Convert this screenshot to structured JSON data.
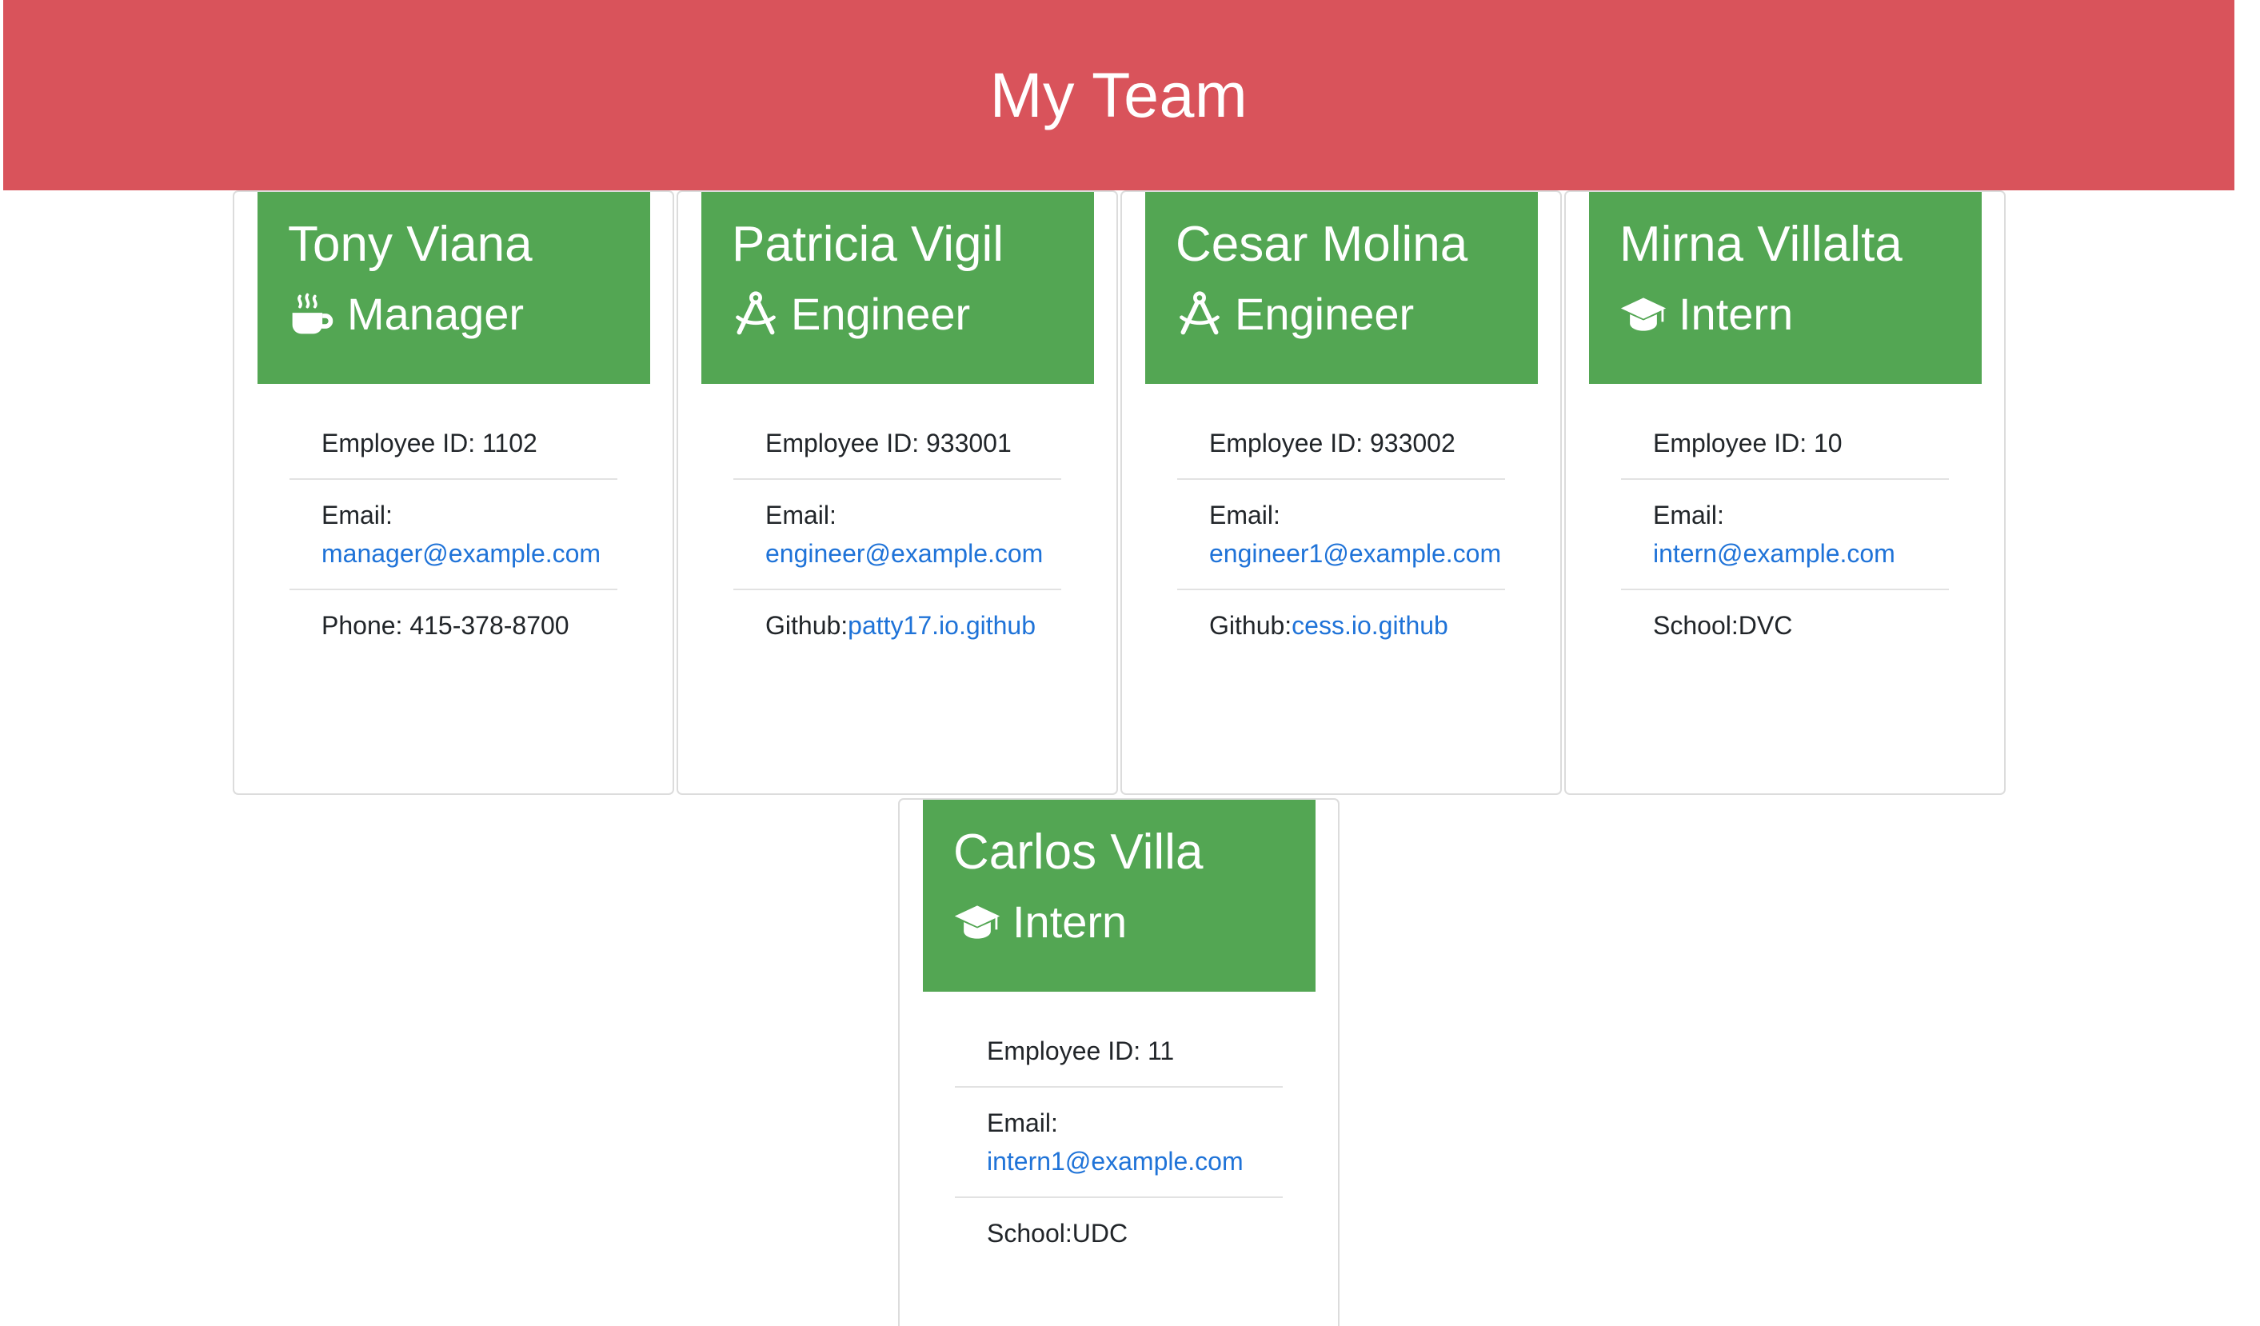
{
  "header": {
    "title": "My Team"
  },
  "employees": [
    {
      "name": "Tony Viana",
      "role": "Manager",
      "icon": "coffee-icon",
      "id_label": "Employee ID: 1102",
      "email_label": "Email:",
      "email": "manager@example.com",
      "extra_label": "Phone: 415-378-8700",
      "extra_link": ""
    },
    {
      "name": "Patricia Vigil",
      "role": "Engineer",
      "icon": "compass-drafting-icon",
      "id_label": "Employee ID: 933001",
      "email_label": "Email:",
      "email": "engineer@example.com",
      "extra_label": "Github:",
      "extra_link": "patty17.io.github"
    },
    {
      "name": "Cesar Molina",
      "role": "Engineer",
      "icon": "compass-drafting-icon",
      "id_label": "Employee ID: 933002",
      "email_label": "Email:",
      "email": "engineer1@example.com",
      "extra_label": "Github:",
      "extra_link": "cess.io.github"
    },
    {
      "name": "Mirna Villalta",
      "role": "Intern",
      "icon": "graduation-cap-icon",
      "id_label": "Employee ID: 10",
      "email_label": "Email:",
      "email": "intern@example.com",
      "extra_label": "School:DVC",
      "extra_link": ""
    },
    {
      "name": "Carlos Villa",
      "role": "Intern",
      "icon": "graduation-cap-icon",
      "id_label": "Employee ID: 11",
      "email_label": "Email:",
      "email": "intern1@example.com",
      "extra_label": "School:UDC",
      "extra_link": ""
    }
  ],
  "colors": {
    "header_bg": "#d9535b",
    "card_header_bg": "#53a653",
    "link": "#1f73d8"
  }
}
